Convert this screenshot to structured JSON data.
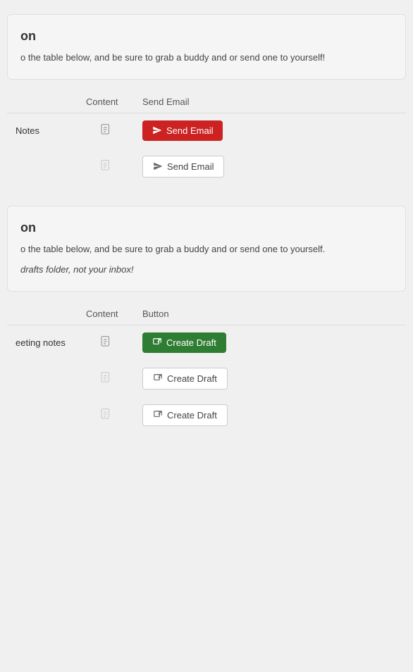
{
  "section1": {
    "title": "on",
    "description": "o the table below, and be sure to grab a buddy and or send one to yourself!",
    "col_label": "",
    "col_content": "Content",
    "col_action": "Send Email",
    "rows": [
      {
        "label": "Notes",
        "has_content": true,
        "button_type": "primary",
        "button_label": "Send Email"
      },
      {
        "label": "",
        "has_content": true,
        "button_type": "outline",
        "button_label": "Send Email"
      }
    ]
  },
  "section2": {
    "title": "on",
    "description": "o the table below, and be sure to grab a buddy and or send one to yourself.",
    "note": "drafts folder, not your inbox!",
    "col_label": "",
    "col_content": "Content",
    "col_action": "Button",
    "rows": [
      {
        "label": "eeting notes",
        "has_content": true,
        "button_type": "primary",
        "button_label": "Create Draft"
      },
      {
        "label": "",
        "has_content": true,
        "button_type": "outline",
        "button_label": "Create Draft"
      },
      {
        "label": "",
        "has_content": true,
        "button_type": "outline",
        "button_label": "Create Draft"
      }
    ]
  }
}
